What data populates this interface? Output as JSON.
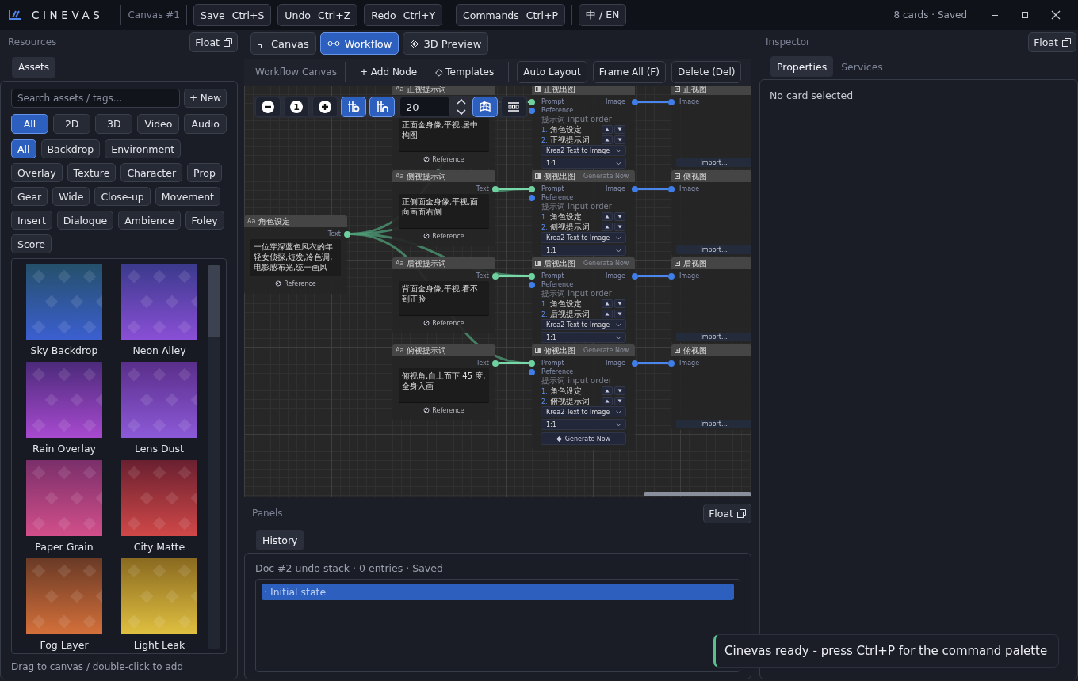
{
  "topbar": {
    "app_name": "CINEVAS",
    "document": "Canvas #1",
    "groups": [
      [
        {
          "label": "Save",
          "shortcut": "Ctrl+S"
        },
        {
          "label": "Undo",
          "shortcut": "Ctrl+Z"
        },
        {
          "label": "Redo",
          "shortcut": "Ctrl+Y"
        }
      ],
      [
        {
          "label": "Commands",
          "shortcut": "Ctrl+P"
        }
      ],
      [
        {
          "label": "中 / EN"
        }
      ]
    ],
    "status": "8 cards · Saved"
  },
  "resources": {
    "title": "Resources",
    "float": "Float",
    "tabs": [
      {
        "label": "Assets",
        "selected": true
      }
    ],
    "search": {
      "placeholder": "Search assets / tags..."
    },
    "new_button": "+ New",
    "type_filters": [
      {
        "label": "All",
        "selected": true
      },
      {
        "label": "2D",
        "selected": false
      },
      {
        "label": "3D",
        "selected": false
      },
      {
        "label": "Video",
        "selected": false
      },
      {
        "label": "Audio",
        "selected": false
      }
    ],
    "tag_filters": [
      {
        "label": "All",
        "selected": true
      },
      {
        "label": "Backdrop",
        "selected": false
      },
      {
        "label": "Environment",
        "selected": false
      },
      {
        "label": "Overlay",
        "selected": false
      },
      {
        "label": "Texture",
        "selected": false
      },
      {
        "label": "Character",
        "selected": false
      },
      {
        "label": "Prop",
        "selected": false
      },
      {
        "label": "Gear",
        "selected": false
      },
      {
        "label": "Wide",
        "selected": false
      },
      {
        "label": "Close-up",
        "selected": false
      },
      {
        "label": "Movement",
        "selected": false
      },
      {
        "label": "Insert",
        "selected": false
      },
      {
        "label": "Dialogue",
        "selected": false
      },
      {
        "label": "Ambience",
        "selected": false
      },
      {
        "label": "Foley",
        "selected": false
      },
      {
        "label": "Score",
        "selected": false
      }
    ],
    "assets": [
      {
        "name": "Sky Backdrop",
        "kind": "picture"
      },
      {
        "name": "Neon Alley",
        "kind": "picture"
      },
      {
        "name": "Rain Overlay",
        "kind": "picture"
      },
      {
        "name": "Lens Dust",
        "kind": "picture"
      },
      {
        "name": "Paper Grain",
        "kind": "picture"
      },
      {
        "name": "City Matte",
        "kind": "picture"
      },
      {
        "name": "Fog Layer",
        "kind": "picture"
      },
      {
        "name": "Light Leak",
        "kind": "picture"
      }
    ],
    "hint": "Drag to canvas / double-click to add"
  },
  "workspace": {
    "tabs": [
      {
        "label": "Canvas",
        "selected": false
      },
      {
        "label": "Workflow",
        "selected": true
      },
      {
        "label": "3D Preview",
        "selected": false
      }
    ],
    "toolbar": {
      "title": "Workflow Canvas",
      "actions": [
        {
          "label": "+ Add Node",
          "kind": "ghost"
        },
        {
          "label": "◇ Templates",
          "kind": "ghost"
        },
        {
          "label": "Auto Layout",
          "kind": "outlined"
        },
        {
          "label": "Frame All (F)",
          "kind": "outlined"
        },
        {
          "label": "Delete (Del)",
          "kind": "outlined"
        }
      ]
    },
    "view_controls": {
      "reset": "1",
      "snap_toggles": [
        {
          "on": true
        },
        {
          "on": true
        }
      ],
      "grid_size": "20",
      "grid_3d_on": true
    },
    "source_node": {
      "badge": "Aa",
      "title": "角色设定",
      "port": "Text",
      "text": "一位穿深蓝色风衣的年轻女侦探,短发,冷色调,电影感布光,统一画风",
      "reference": "Reference"
    },
    "rows": [
      {
        "prompt": {
          "badge": "Aa",
          "title": "正视提示词",
          "text": "正面全身像,平视,居中构图",
          "reference": "Reference"
        },
        "generator": {
          "title": "正视出图",
          "input": "Prompt",
          "reference": "Reference",
          "output": "Image",
          "order_label": "提示词 input order",
          "order": [
            {
              "index": "1.",
              "name": "角色设定"
            },
            {
              "index": "2.",
              "name": "正视提示词"
            }
          ],
          "model": "Krea2 Text to Image",
          "ratio": "1:1"
        },
        "viewer": {
          "title": "正视图",
          "input": "Image",
          "import": "Import..."
        }
      },
      {
        "prompt": {
          "badge": "Aa",
          "title": "侧视提示词",
          "port": "Text",
          "text": "正侧面全身像,平视,面向画面右侧",
          "reference": "Reference"
        },
        "generator": {
          "title": "侧视出图",
          "action": "Generate Now",
          "input": "Prompt",
          "reference": "Reference",
          "output": "Image",
          "order_label": "提示词 input order",
          "order": [
            {
              "index": "1.",
              "name": "角色设定"
            },
            {
              "index": "2.",
              "name": "侧视提示词"
            }
          ],
          "model": "Krea2 Text to Image",
          "ratio": "1:1"
        },
        "viewer": {
          "title": "侧视图",
          "input": "Image",
          "import": "Import..."
        }
      },
      {
        "prompt": {
          "badge": "Aa",
          "title": "后视提示词",
          "port": "Text",
          "text": "背面全身像,平视,看不到正脸",
          "reference": "Reference"
        },
        "generator": {
          "title": "后视出图",
          "action": "Generate Now",
          "input": "Prompt",
          "reference": "Reference",
          "output": "Image",
          "order_label": "提示词 input order",
          "order": [
            {
              "index": "1.",
              "name": "角色设定"
            },
            {
              "index": "2.",
              "name": "后视提示词"
            }
          ],
          "model": "Krea2 Text to Image",
          "ratio": "1:1"
        },
        "viewer": {
          "title": "后视图",
          "input": "Image",
          "import": "Import..."
        }
      },
      {
        "prompt": {
          "badge": "Aa",
          "title": "俯视提示词",
          "port": "Text",
          "text": "俯视角,自上而下 45 度,全身入画",
          "reference": "Reference"
        },
        "generator": {
          "title": "俯视出图",
          "action": "Generate Now",
          "input": "Prompt",
          "reference": "Reference",
          "output": "Image",
          "order_label": "提示词 input order",
          "order": [
            {
              "index": "1.",
              "name": "角色设定"
            },
            {
              "index": "2.",
              "name": "俯视提示词"
            }
          ],
          "model": "Krea2 Text to Image",
          "ratio": "1:1",
          "button": "Generate Now"
        },
        "viewer": {
          "title": "俯视图",
          "input": "Image",
          "import": "Import..."
        }
      }
    ]
  },
  "panels": {
    "title": "Panels",
    "float": "Float",
    "tabs": [
      {
        "label": "History",
        "selected": true
      }
    ],
    "summary": "Doc #2 undo stack · 0 entries · Saved",
    "entries": [
      {
        "label": "· Initial state",
        "selected": true
      }
    ]
  },
  "inspector": {
    "title": "Inspector",
    "float": "Float",
    "tabs": [
      {
        "label": "Properties",
        "selected": true
      },
      {
        "label": "Services",
        "selected": false
      }
    ],
    "empty": "No card selected"
  },
  "toast": "Cinevas ready - press Ctrl+P for the command palette"
}
